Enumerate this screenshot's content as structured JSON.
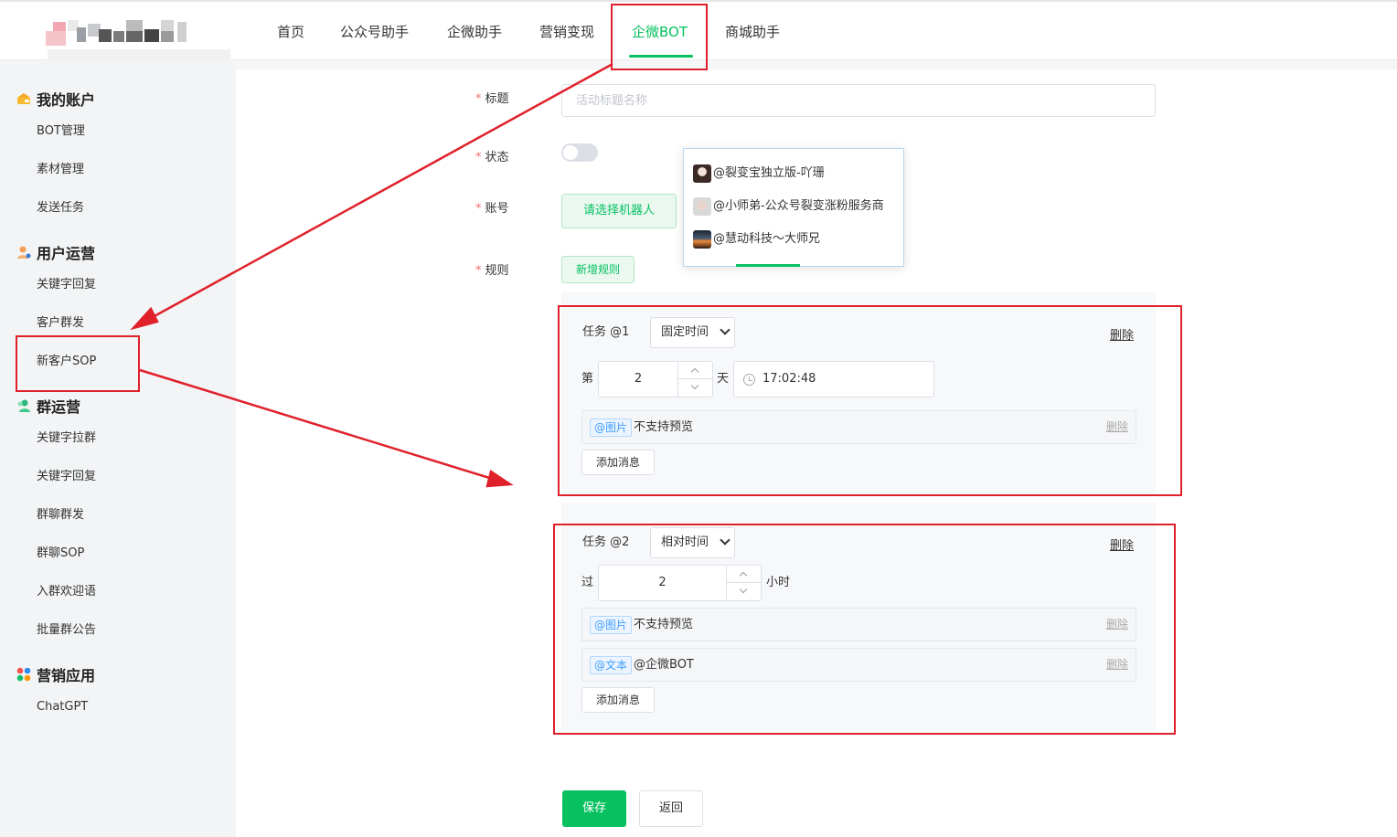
{
  "nav": {
    "items": [
      {
        "label": "首页",
        "active": false
      },
      {
        "label": "公众号助手",
        "active": false
      },
      {
        "label": "企微助手",
        "active": false
      },
      {
        "label": "营销变现",
        "active": false
      },
      {
        "label": "企微BOT",
        "active": true
      },
      {
        "label": "商城助手",
        "active": false
      }
    ],
    "accent": "#07c160"
  },
  "sidebar": {
    "groups": [
      {
        "title": "我的账户",
        "icon": "wallet-icon",
        "items": [
          "BOT管理",
          "素材管理",
          "发送任务"
        ]
      },
      {
        "title": "用户运营",
        "icon": "user-icon",
        "items": [
          "关键字回复",
          "客户群发",
          "新客户SOP"
        ]
      },
      {
        "title": "群运营",
        "icon": "group-icon",
        "items": [
          "关键字拉群",
          "关键字回复",
          "群聊群发",
          "群聊SOP",
          "入群欢迎语",
          "批量群公告"
        ]
      },
      {
        "title": "营销应用",
        "icon": "apps-icon",
        "items": [
          "ChatGPT"
        ]
      }
    ]
  },
  "form": {
    "title_label": "标题",
    "title_placeholder": "活动标题名称",
    "status_label": "状态",
    "status_on": false,
    "account_label": "账号",
    "account_button": "请选择机器人",
    "rule_label": "规则",
    "rule_button": "新增规则",
    "required_mark": "*"
  },
  "robot_dropdown": {
    "options": [
      "@裂变宝独立版-吖珊",
      "@小师弟-公众号裂变涨粉服务商",
      "@慧动科技～大师兄"
    ]
  },
  "tasks": [
    {
      "label": "任务 @1",
      "mode": "固定时间",
      "delete": "删除",
      "prefix": "第",
      "number": "2",
      "unit": "天",
      "time": "17:02:48",
      "messages": [
        {
          "tag": "@图片",
          "text": "不支持预览",
          "delete": "删除"
        }
      ],
      "add_button": "添加消息"
    },
    {
      "label": "任务 @2",
      "mode": "相对时间",
      "delete": "删除",
      "prefix": "过",
      "number": "2",
      "unit": "小时",
      "messages": [
        {
          "tag": "@图片",
          "text": "不支持预览",
          "delete": "删除"
        },
        {
          "tag": "@文本",
          "text": "@企微BOT",
          "delete": "删除"
        }
      ],
      "add_button": "添加消息"
    }
  ],
  "footer": {
    "save": "保存",
    "back": "返回"
  },
  "annotation_color": "#e0212b"
}
